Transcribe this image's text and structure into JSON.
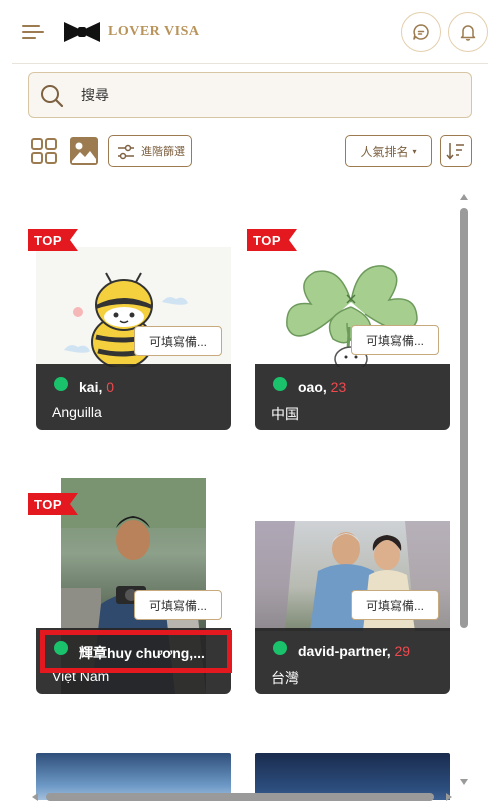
{
  "header": {
    "logo_text": "LOVER VISA",
    "icons": {
      "menu": "menu-icon",
      "chat": "chat-icon",
      "bell": "bell-icon",
      "logo": "bowtie-logo"
    }
  },
  "search": {
    "placeholder": "搜尋",
    "value": ""
  },
  "toolbar": {
    "view_modes": [
      "grid-view",
      "photo-view"
    ],
    "advanced_filter_label": "進階篩選",
    "sort_label": "人氣排名",
    "sort_caret": "▾"
  },
  "colors": {
    "accent": "#9b7b4f",
    "brand_gold": "#b8935a",
    "online": "#19c26b",
    "age": "#f0494e",
    "top_badge": "#e4181f",
    "highlight": "#e4181f"
  },
  "cards": [
    {
      "name": "kai",
      "age": "0",
      "country": "Anguilla",
      "top": true,
      "online": true,
      "note_label": "可填寫備..."
    },
    {
      "name": "oao",
      "age": "23",
      "country": "中国",
      "top": true,
      "online": true,
      "note_label": "可填寫備..."
    },
    {
      "name": "輝章huy chương,...",
      "age": "",
      "country": "Việt Nam",
      "top": true,
      "online": true,
      "note_label": "可填寫備...",
      "highlighted": true
    },
    {
      "name": "david-partner",
      "age": "29",
      "country": "台灣",
      "top": false,
      "online": true,
      "note_label": "可填寫備..."
    }
  ],
  "top_badge_label": "TOP"
}
